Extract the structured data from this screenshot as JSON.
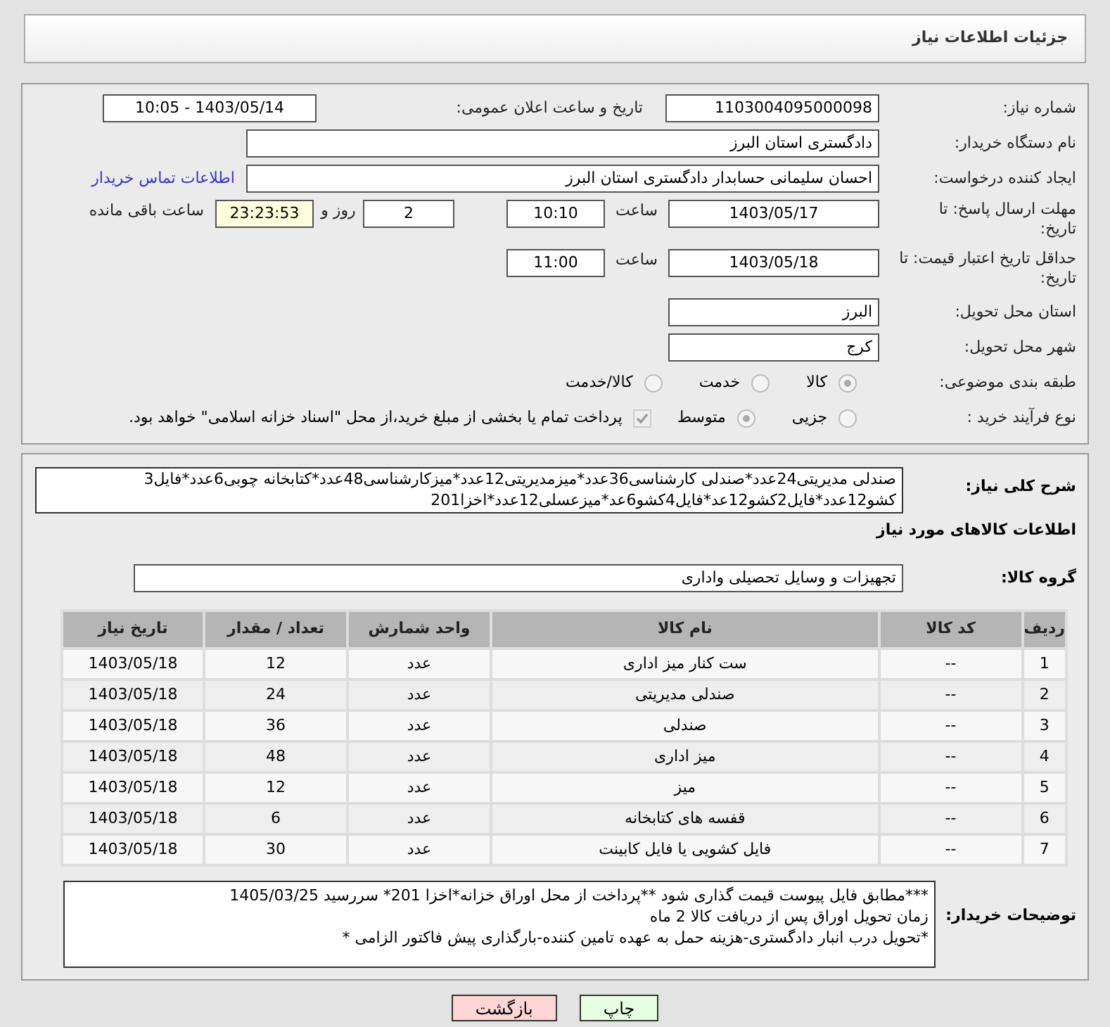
{
  "header": {
    "title": "جزئیات اطلاعات نیاز"
  },
  "form": {
    "need_number": {
      "label": "شماره نیاز:",
      "value": "1103004095000098"
    },
    "announce": {
      "label": "تاریخ و ساعت اعلان عمومی:",
      "value": "1403/05/14 - 10:05"
    },
    "buyer_org": {
      "label": "نام دستگاه خریدار:",
      "value": "دادگستری استان البرز"
    },
    "requester": {
      "label": "ایجاد کننده درخواست:",
      "value": "احسان سلیمانی حسابدار دادگستری استان البرز",
      "link": "اطلاعات تماس خریدار"
    },
    "reply_deadline": {
      "label": "مهلت ارسال پاسخ: تا تاریخ:",
      "date": "1403/05/17",
      "time_label": "ساعت",
      "time": "10:10",
      "days": "2",
      "days_label": "روز و",
      "remaining": "23:23:53",
      "remaining_label": "ساعت باقی مانده"
    },
    "price_validity": {
      "label": "حداقل تاریخ اعتبار قیمت: تا تاریخ:",
      "date": "1403/05/18",
      "time_label": "ساعت",
      "time": "11:00"
    },
    "province": {
      "label": "استان محل تحویل:",
      "value": "البرز"
    },
    "city": {
      "label": "شهر محل تحویل:",
      "value": "کرج"
    },
    "category": {
      "label": "طبقه بندی موضوعی:",
      "options": [
        {
          "label": "کالا",
          "selected": true
        },
        {
          "label": "خدمت",
          "selected": false
        },
        {
          "label": "کالا/خدمت",
          "selected": false
        }
      ]
    },
    "process": {
      "label": "نوع فرآیند خرید :",
      "options": [
        {
          "label": "جزیی",
          "selected": false
        },
        {
          "label": "متوسط",
          "selected": true
        }
      ],
      "payment": {
        "label": "پرداخت تمام یا بخشی از مبلغ خرید،از محل \"اسناد خزانه اسلامی\" خواهد بود.",
        "checked": true,
        "disabled": true
      }
    }
  },
  "details": {
    "description": {
      "label": "شرح کلی نیاز:",
      "value": "صندلی مدیریتی24عدد*صندلی کارشناسی36عدد*میزمدیریتی12عدد*میزکارشناسی48عدد*کتابخانه چوبی6عدد*فایل3 کشو12عدد*فایل2کشو12عد*فایل4کشو6عد*میزعسلی12عدد*اخزا201"
    },
    "section_title": "اطلاعات کالاهای مورد نیاز",
    "group": {
      "label": "گروه کالا:",
      "value": "تجهیزات و وسایل تحصیلی واداری"
    },
    "table": {
      "columns": [
        "ردیف",
        "کد کالا",
        "نام کالا",
        "واحد شمارش",
        "تعداد / مقدار",
        "تاریخ نیاز"
      ],
      "rows": [
        [
          "1",
          "--",
          "ست کنار میز اداری",
          "عدد",
          "12",
          "1403/05/18"
        ],
        [
          "2",
          "--",
          "صندلی مدیریتی",
          "عدد",
          "24",
          "1403/05/18"
        ],
        [
          "3",
          "--",
          "صندلی",
          "عدد",
          "36",
          "1403/05/18"
        ],
        [
          "4",
          "--",
          "میز اداری",
          "عدد",
          "48",
          "1403/05/18"
        ],
        [
          "5",
          "--",
          "میز",
          "عدد",
          "12",
          "1403/05/18"
        ],
        [
          "6",
          "--",
          "قفسه های کتابخانه",
          "عدد",
          "6",
          "1403/05/18"
        ],
        [
          "7",
          "--",
          "فایل کشویی یا فایل کابینت",
          "عدد",
          "30",
          "1403/05/18"
        ]
      ]
    },
    "buyer_notes": {
      "label": "توضیحات خریدار:",
      "lines": [
        "***مطابق فایل پیوست قیمت گذاری شود **پرداخت از محل اوراق خزانه*اخزا 201* سررسید 1405/03/25",
        "زمان تحویل اوراق پس از دریافت کالا 2 ماه",
        "*تحویل درب انبار دادگستری-هزینه حمل به عهده تامین کننده-بارگذاری پیش فاکتور الزامی *"
      ]
    }
  },
  "buttons": [
    {
      "label": "چاپ",
      "kind": "print"
    },
    {
      "label": "بازگشت",
      "kind": "back"
    }
  ]
}
